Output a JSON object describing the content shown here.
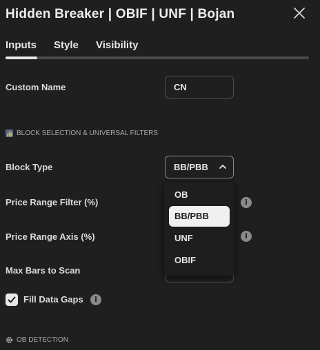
{
  "dialog": {
    "title": "Hidden Breaker | OBIF | UNF | Bojan"
  },
  "tabs": [
    {
      "label": "Inputs",
      "active": true
    },
    {
      "label": "Style",
      "active": false
    },
    {
      "label": "Visibility",
      "active": false
    }
  ],
  "fields": {
    "custom_name": {
      "label": "Custom Name",
      "value": "CN"
    },
    "section_block": {
      "label": "BLOCK SELECTION & UNIVERSAL FILTERS"
    },
    "block_type": {
      "label": "Block Type",
      "value": "BB/PBB"
    },
    "price_range_filter": {
      "label": "Price Range Filter (%)"
    },
    "price_range_axis": {
      "label": "Price Range Axis (%)"
    },
    "max_bars": {
      "label": "Max Bars to Scan"
    },
    "fill_data_gaps": {
      "label": "Fill Data Gaps",
      "checked": true
    },
    "section_ob": {
      "label": "OB DETECTION"
    }
  },
  "dropdown": {
    "options": [
      "OB",
      "BB/PBB",
      "UNF",
      "OBIF"
    ],
    "selected": "BB/PBB"
  },
  "icons": {
    "info": "i"
  },
  "colors": {
    "background": "#1f1f1f",
    "text": "#e6e6e6",
    "muted": "#a9a9a9",
    "selected_option_bg": "#f0f0f0"
  }
}
